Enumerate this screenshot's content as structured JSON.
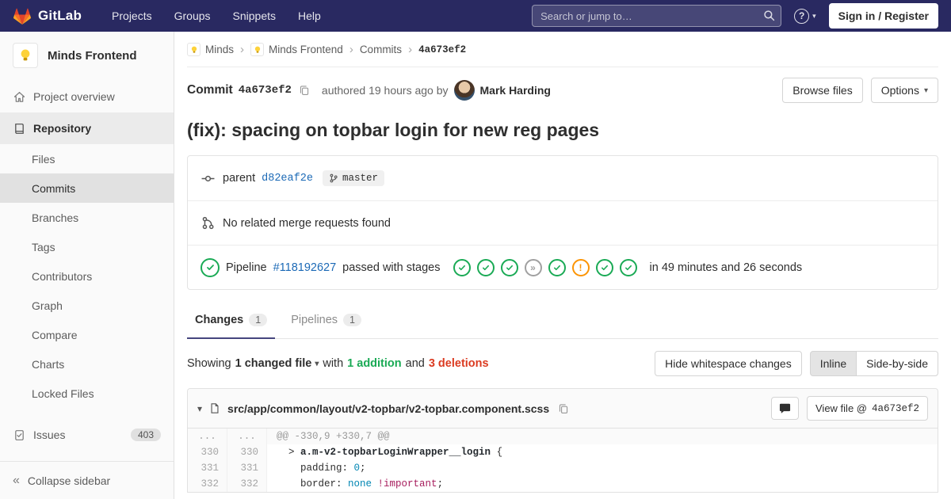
{
  "colors": {
    "navbar_bg": "#292961",
    "link_blue": "#1b69b6",
    "success_green": "#1aaa55",
    "warning_orange": "#fc9403",
    "danger_red": "#db3b21",
    "tanuki_red": "#e24329",
    "tanuki_orange": "#fc6d26",
    "tanuki_yellow": "#fca326"
  },
  "navbar": {
    "brand": "GitLab",
    "links": [
      "Projects",
      "Groups",
      "Snippets",
      "Help"
    ],
    "search_placeholder": "Search or jump to…",
    "help": "?",
    "sign_in": "Sign in / Register"
  },
  "sidebar": {
    "project_name": "Minds Frontend",
    "overview_label": "Project overview",
    "repository_label": "Repository",
    "repo_items": [
      {
        "label": "Files"
      },
      {
        "label": "Commits",
        "active": true
      },
      {
        "label": "Branches"
      },
      {
        "label": "Tags"
      },
      {
        "label": "Contributors"
      },
      {
        "label": "Graph"
      },
      {
        "label": "Compare"
      },
      {
        "label": "Charts"
      },
      {
        "label": "Locked Files"
      }
    ],
    "issues_label": "Issues",
    "issues_count": "403",
    "collapse_label": "Collapse sidebar"
  },
  "breadcrumb": {
    "items": [
      {
        "label": "Minds",
        "avatar": true
      },
      {
        "label": "Minds Frontend",
        "avatar": true
      },
      {
        "label": "Commits"
      },
      {
        "label": "4a673ef2",
        "current": true
      }
    ]
  },
  "commit": {
    "label": "Commit",
    "sha": "4a673ef2",
    "authored_text": "authored 19 hours ago by",
    "author": "Mark Harding",
    "browse_files_label": "Browse files",
    "options_label": "Options",
    "title": "(fix): spacing on topbar login for new reg pages"
  },
  "info": {
    "parent_label": "parent",
    "parent_sha": "d82eaf2e",
    "branch": "master",
    "no_mr_text": "No related merge requests found",
    "pipeline_label": "Pipeline",
    "pipeline_id": "#118192627",
    "pipeline_status": "passed with stages",
    "pipeline_duration": "in 49 minutes and 26 seconds",
    "stages": [
      "passed",
      "passed",
      "passed",
      "skipped",
      "passed",
      "warning",
      "passed",
      "passed"
    ]
  },
  "tabs": [
    {
      "label": "Changes",
      "count": "1",
      "active": true
    },
    {
      "label": "Pipelines",
      "count": "1"
    }
  ],
  "summary": {
    "showing": "Showing",
    "changed_file": "1 changed file",
    "with_text": "with",
    "additions": "1 addition",
    "and_text": "and",
    "deletions": "3 deletions",
    "hide_whitespace": "Hide whitespace changes",
    "inline": "Inline",
    "side_by_side": "Side-by-side"
  },
  "diff": {
    "file_path": "src/app/common/layout/v2-topbar/v2-topbar.component.scss",
    "view_file_prefix": "View file @",
    "view_file_sha": "4a673ef2",
    "hunk_header": "@@ -330,9 +330,7 @@",
    "hunk_ellipsis": "...",
    "lines": [
      {
        "old": "330",
        "new": "330",
        "tokens": [
          {
            "t": "  > ",
            "c": ""
          },
          {
            "t": "a.m-v2-topbarLoginWrapper__login",
            "c": "sel"
          },
          {
            "t": " {",
            "c": ""
          }
        ]
      },
      {
        "old": "331",
        "new": "331",
        "tokens": [
          {
            "t": "    padding: ",
            "c": ""
          },
          {
            "t": "0",
            "c": "num"
          },
          {
            "t": ";",
            "c": ""
          }
        ]
      },
      {
        "old": "332",
        "new": "332",
        "tokens": [
          {
            "t": "    border: ",
            "c": ""
          },
          {
            "t": "none",
            "c": "num"
          },
          {
            "t": " ",
            "c": ""
          },
          {
            "t": "!important",
            "c": "imp"
          },
          {
            "t": ";",
            "c": ""
          }
        ]
      }
    ]
  }
}
